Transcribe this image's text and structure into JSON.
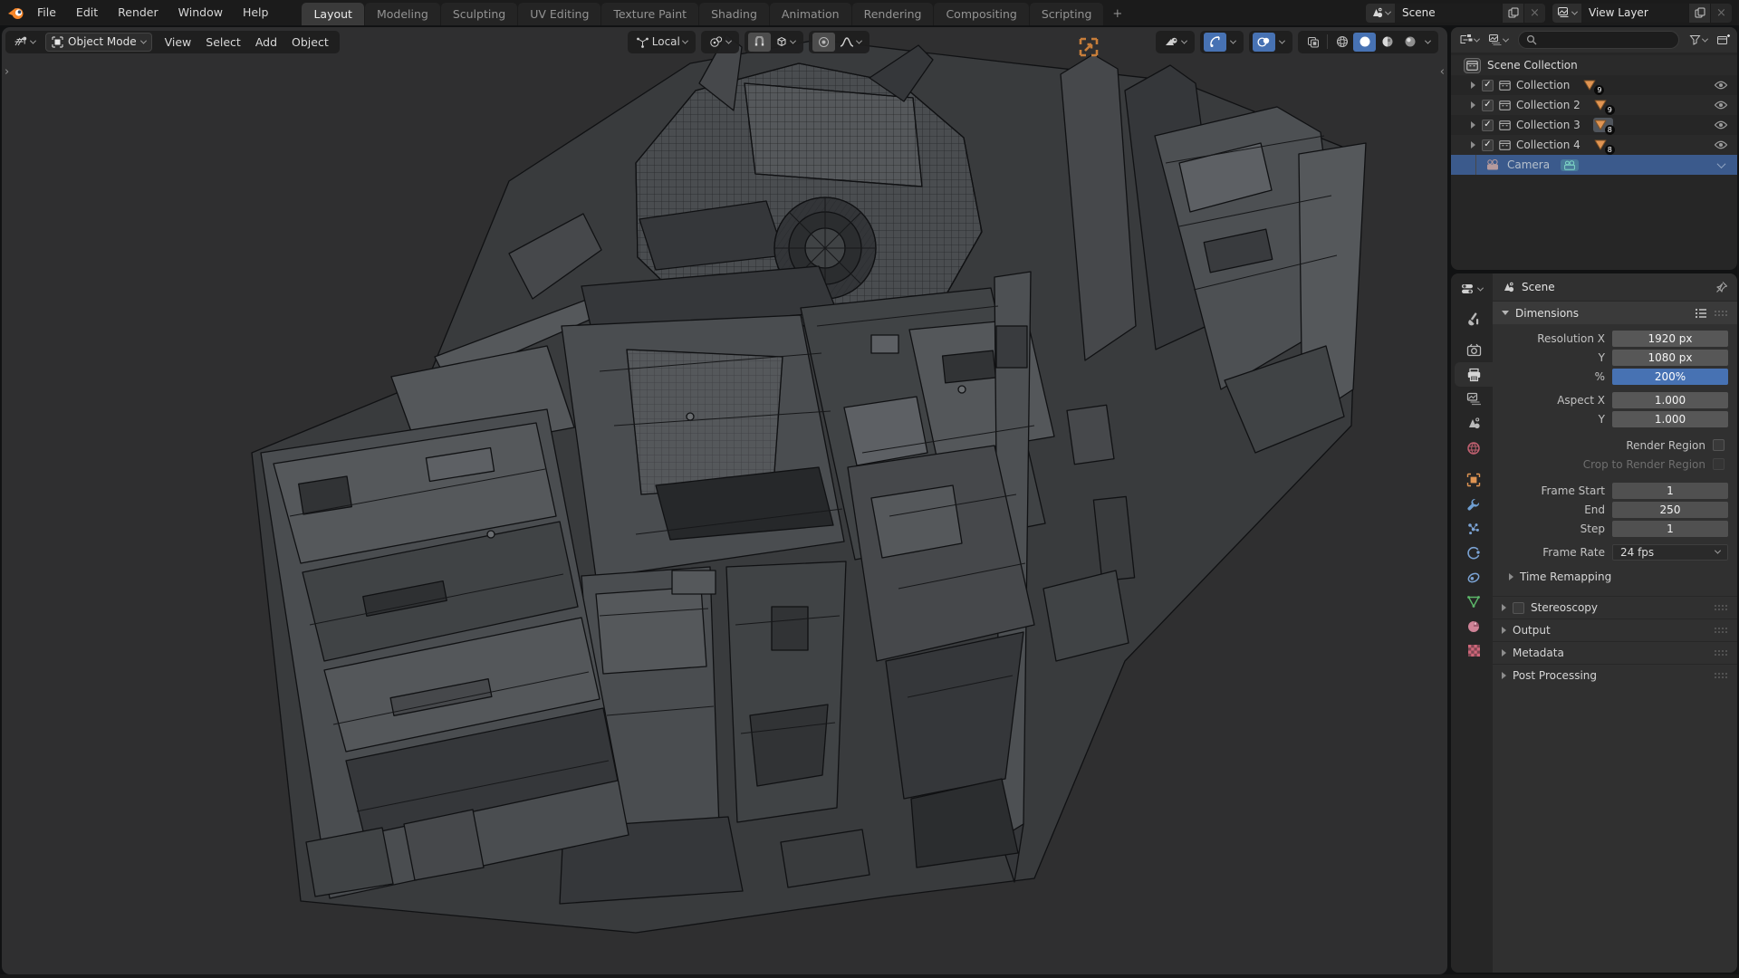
{
  "topbar": {
    "menus": [
      "File",
      "Edit",
      "Render",
      "Window",
      "Help"
    ],
    "tabs": [
      "Layout",
      "Modeling",
      "Sculpting",
      "UV Editing",
      "Texture Paint",
      "Shading",
      "Animation",
      "Rendering",
      "Compositing",
      "Scripting"
    ],
    "add_tab": "+",
    "active_tab": "Layout",
    "scene": {
      "value": "Scene"
    },
    "view_layer": {
      "value": "View Layer"
    }
  },
  "viewport": {
    "header": {
      "mode": "Object Mode",
      "menus": [
        "View",
        "Select",
        "Add",
        "Object"
      ],
      "orientation": "Local"
    }
  },
  "outliner": {
    "root": "Scene Collection",
    "rows": [
      {
        "name": "Collection",
        "count": "9"
      },
      {
        "name": "Collection 2",
        "count": "9"
      },
      {
        "name": "Collection 3",
        "count": "8"
      },
      {
        "name": "Collection 4",
        "count": "8"
      }
    ],
    "camera": {
      "name": "Camera"
    }
  },
  "properties": {
    "breadcrumb": "Scene",
    "dimensions": {
      "title": "Dimensions",
      "rows": [
        {
          "label": "Resolution X",
          "value": "1920 px"
        },
        {
          "label": "Y",
          "value": "1080 px"
        },
        {
          "label": "%",
          "value": "200%"
        },
        {
          "label": "Aspect X",
          "value": "1.000"
        },
        {
          "label": "Y",
          "value": "1.000"
        }
      ],
      "render_region": "Render Region",
      "crop": "Crop to Render Region",
      "frame_rows": [
        {
          "label": "Frame Start",
          "value": "1"
        },
        {
          "label": "End",
          "value": "250"
        },
        {
          "label": "Step",
          "value": "1"
        }
      ],
      "frame_rate_label": "Frame Rate",
      "frame_rate_value": "24 fps",
      "subpanel": "Time Remapping"
    },
    "panels": [
      "Stereoscopy",
      "Output",
      "Metadata",
      "Post Processing"
    ]
  },
  "icons": {
    "check": "✓",
    "close": "×",
    "toolbar_expand": "›",
    "sidebar_expand": "‹"
  },
  "colors": {
    "accent_blue": "#4772b3",
    "selection_blue": "#3b5a8c",
    "object_orange": "#e09553",
    "gizmo_orange": "#c87e3a",
    "viewport_bg": "#2f2f30",
    "topbar_bg": "#1b1b1b",
    "panel_bg": "#303030",
    "data_green": "#5cb86a",
    "material_pink": "#cf8397",
    "world_red": "#c06070"
  }
}
